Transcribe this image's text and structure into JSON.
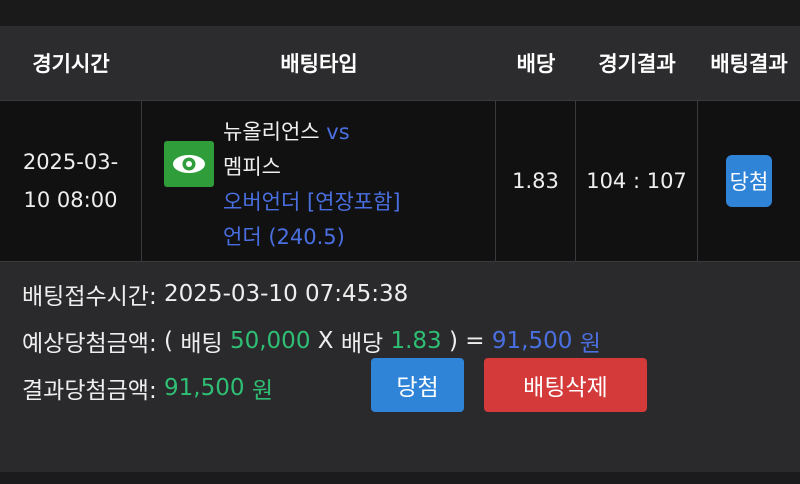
{
  "table": {
    "headers": [
      "경기시간",
      "배팅타입",
      "배당",
      "경기결과",
      "배팅결과"
    ],
    "row": {
      "time_date": "2025-03-",
      "time_rest": "10 08:00",
      "home_team": "뉴올리언스",
      "vs": "vs",
      "away_team": "멤피스",
      "bet_market": "오버언더 [연장포함]",
      "bet_pick": "언더 (240.5)",
      "odds": "1.83",
      "score": "104 : 107",
      "result_badge": "당첨"
    }
  },
  "info": {
    "accept_label": "배팅접수시간:",
    "accept_time": "2025-03-10 07:45:38",
    "expected_label": "예상당첨금액:",
    "open_paren": "(",
    "bet_word": "배팅",
    "bet_amount": "50,000",
    "times": "X",
    "odds_word": "배당",
    "odds_value": "1.83",
    "close_eq": ") =",
    "expected_amount": "91,500",
    "won": "원",
    "result_label": "결과당첨금액:",
    "result_amount": "91,500",
    "result_won": "원"
  },
  "buttons": {
    "win": "당첨",
    "delete": "배팅삭제"
  },
  "colors": {
    "accent_blue": "#2f84d8",
    "danger_red": "#d43a3a",
    "money_green": "#2fbf74",
    "link_blue": "#4a6fe0",
    "logo_green": "#2f9e3a"
  },
  "icons": {
    "team_logo": "eye-icon"
  }
}
